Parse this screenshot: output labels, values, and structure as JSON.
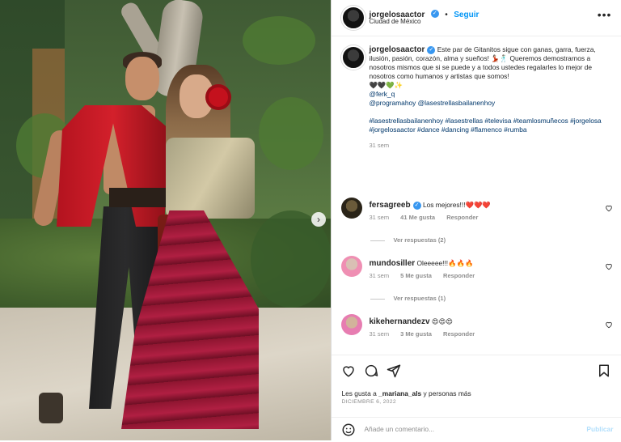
{
  "post": {
    "author": "jorgelosaactor",
    "follow_label": "Seguir",
    "follow_separator": "•",
    "location": "Ciudad de México",
    "more_label": "•••",
    "verified_mark": "✓",
    "caption_part1": "Este par de Gitanitos sigue con ganas, garra, fuerza, ilusión, pasión, corazón, alma y sueños! 💃🏻🕺🏻 Queremos demostrarnos a nosotros mismos que si se puede y a todos ustedes regalarles lo mejor de nosotros como humanos y artistas que somos!",
    "caption_emojis": "🖤🖤💚✨",
    "mention1": "@ferk_q",
    "mention2": "@programahoy @lasestrellasbailanenhoy",
    "hashtags": "#lasestrellasbailanenhoy #lasestrellas #televisa #teamlosmuñecos #jorgelosa #jorgelosaactor #dance #dancing #flamenco #rumba",
    "caption_time": "31 sem",
    "likes_prefix": "Les gusta a ",
    "likes_user": "_mariana_als",
    "likes_suffix": " y personas más",
    "date": "DICIEMBRE 6, 2022"
  },
  "comments": [
    {
      "user": "fersagreeb",
      "verified": true,
      "text": "Los mejores!!!❤️❤️❤️",
      "time": "31 sem",
      "likes": "41 Me gusta",
      "reply": "Responder",
      "view_replies": "Ver respuestas (2)"
    },
    {
      "user": "mundosiller",
      "verified": false,
      "text": "Oleeeee!!!🔥🔥🔥",
      "time": "31 sem",
      "likes": "5 Me gusta",
      "reply": "Responder",
      "view_replies": "Ver respuestas (1)"
    },
    {
      "user": "kikehernandezv",
      "verified": false,
      "text": "😍😍😍",
      "time": "31 sem",
      "likes": "3 Me gusta",
      "reply": "Responder",
      "view_replies": ""
    }
  ],
  "composer": {
    "placeholder": "Añade un comentario...",
    "publish": "Publicar"
  },
  "carousel": {
    "next_icon": "›"
  },
  "icons": [
    "heart-icon",
    "comment-icon",
    "share-icon",
    "bookmark-icon",
    "emoji-icon",
    "more-icon",
    "chevron-right-icon"
  ],
  "colors": {
    "link": "#00376b",
    "accent": "#0095f6",
    "muted": "#8e8e8e",
    "verified": "#3897f0"
  }
}
